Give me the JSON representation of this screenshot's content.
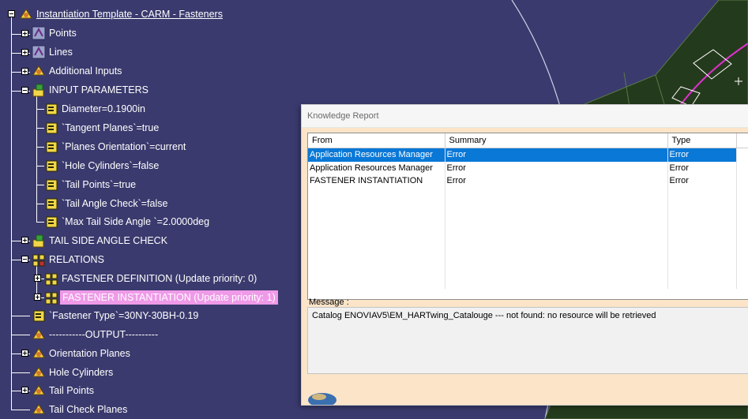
{
  "tree": {
    "root": "Instantiation Template - CARM - Fasteners",
    "nodes": [
      {
        "label": "Points"
      },
      {
        "label": "Lines"
      },
      {
        "label": "Additional Inputs"
      },
      {
        "label": "INPUT PARAMETERS"
      },
      {
        "label": "Diameter=0.1900in"
      },
      {
        "label": "`Tangent Planes`=true"
      },
      {
        "label": "`Planes Orientation`=current"
      },
      {
        "label": "`Hole Cylinders`=false"
      },
      {
        "label": "`Tail Points`=true"
      },
      {
        "label": "`Tail Angle Check`=false"
      },
      {
        "label": "`Max Tail Side Angle `=2.0000deg"
      },
      {
        "label": "TAIL SIDE ANGLE CHECK"
      },
      {
        "label": "RELATIONS"
      },
      {
        "label": "FASTENER DEFINITION (Update priority: 0)"
      },
      {
        "label": "FASTENER INSTANTIATION (Update priority: 1)"
      },
      {
        "label": "`Fastener Type`=30NY-30BH-0.19"
      },
      {
        "label": "-----------OUTPUT----------"
      },
      {
        "label": "Orientation Planes"
      },
      {
        "label": "Hole Cylinders"
      },
      {
        "label": "Tail Points"
      },
      {
        "label": "Tail Check Planes"
      }
    ]
  },
  "report": {
    "title": "Knowledge Report",
    "columns": [
      "From",
      "Summary",
      "Type"
    ],
    "rows": [
      {
        "from": "Application Resources Manager",
        "summary": "Error",
        "type": "Error"
      },
      {
        "from": "Application Resources Manager",
        "summary": "Error",
        "type": "Error"
      },
      {
        "from": "FASTENER INSTANTIATION",
        "summary": "Error",
        "type": "Error"
      }
    ],
    "message_label": "Message :",
    "message": "Catalog ENOVIAV5\\EM_HARTwing_Catalouge ---  not found: no resource will be retrieved"
  },
  "colors": {
    "viewport_bg": "#3a3a6e",
    "selection_blue": "#0a78d7",
    "tree_highlight": "#ef9ae8",
    "dialog_bg": "#fbe4c8"
  }
}
